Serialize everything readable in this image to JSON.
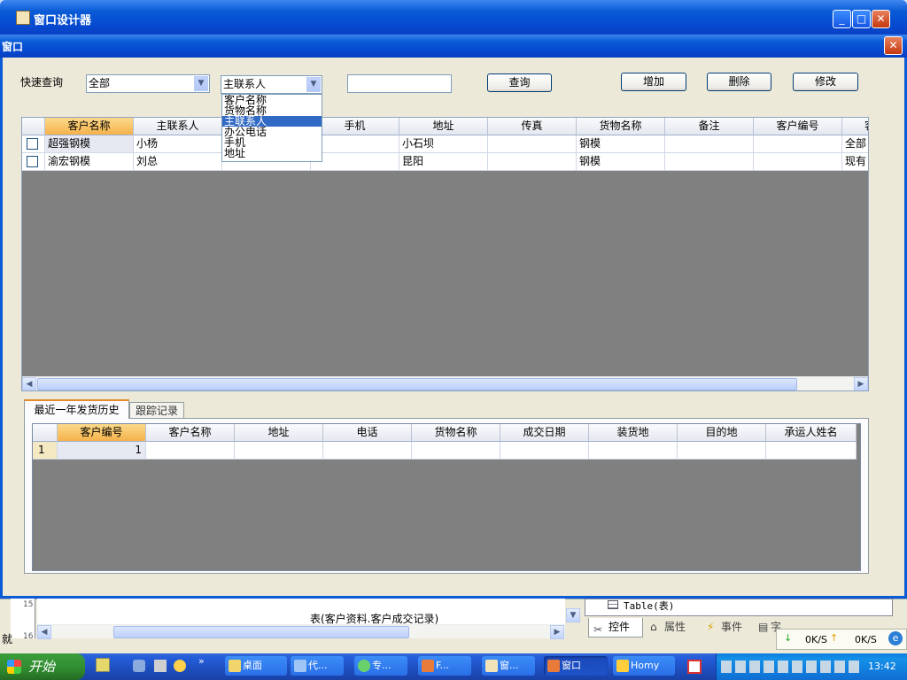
{
  "outer_window": {
    "title": "窗口设计器",
    "min": "_",
    "max": "□",
    "close": "✕"
  },
  "dialog": {
    "title": "窗口",
    "close": "✕"
  },
  "toolbar": {
    "quick_query_label": "快速查询",
    "scope_value": "全部",
    "field_value": "主联系人",
    "search_value": "",
    "query_btn": "查询",
    "add_btn": "增加",
    "delete_btn": "删除",
    "edit_btn": "修改"
  },
  "field_dropdown": {
    "options": [
      "客户名称",
      "货物名称",
      "主联系人",
      "办公电话",
      "手机",
      "地址"
    ],
    "selected_index": 2
  },
  "main_grid": {
    "columns": [
      "客户名称",
      "主联系人",
      "",
      "手机",
      "地址",
      "传真",
      "货物名称",
      "备注",
      "客户编号",
      "客"
    ],
    "rows": [
      [
        "超强钢模",
        "小杨",
        "",
        "",
        "小石坝",
        "",
        "钢模",
        "",
        "",
        "全部"
      ],
      [
        "渝宏钢模",
        "刘总",
        "",
        "",
        "昆阳",
        "",
        "钢模",
        "",
        "",
        "现有"
      ]
    ]
  },
  "tabs": [
    "最近一年发货历史",
    "跟踪记录"
  ],
  "sub_grid": {
    "columns": [
      "客户编号",
      "客户名称",
      "地址",
      "电话",
      "货物名称",
      "成交日期",
      "装货地",
      "目的地",
      "承运人姓名"
    ],
    "rows": [
      {
        "row_no": "1",
        "cells": [
          "1",
          "",
          "",
          "",
          "",
          "",
          "",
          "",
          ""
        ]
      }
    ]
  },
  "designer_back": {
    "ruler_15": "15",
    "ruler_16": "16",
    "status_char": "就",
    "table_caption": "表(客户资料.客户成交记录)",
    "tree_item": "Table(表)",
    "bottom_tabs": [
      "控件",
      "属性",
      "事件",
      "字段"
    ],
    "net_down": "0K/S",
    "net_up": "0K/S"
  },
  "taskbar": {
    "start": "开始",
    "items": [
      "桌面",
      "代...",
      "专...",
      "F...",
      "窗...",
      "窗口",
      "Homy"
    ],
    "clock": "13:42"
  },
  "colors": {
    "accent_blue": "#0a5bd6",
    "header_selected": "#f5b24b",
    "selection": "#316ac5",
    "grid_bg": "#808080"
  }
}
